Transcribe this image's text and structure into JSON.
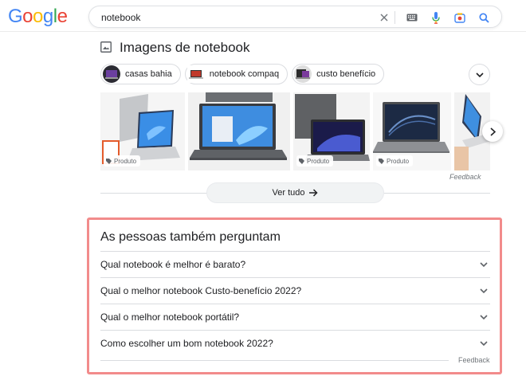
{
  "header": {
    "logo_letters": [
      {
        "char": "G",
        "color": "#4285F4"
      },
      {
        "char": "o",
        "color": "#EA4335"
      },
      {
        "char": "o",
        "color": "#FBBC05"
      },
      {
        "char": "g",
        "color": "#4285F4"
      },
      {
        "char": "l",
        "color": "#34A853"
      },
      {
        "char": "e",
        "color": "#EA4335"
      }
    ],
    "search_query": "notebook",
    "icons": [
      "clear-icon",
      "keyboard-icon",
      "microphone-icon",
      "camera-lens-icon",
      "search-icon"
    ]
  },
  "images": {
    "title": "Imagens de notebook",
    "chips": [
      {
        "label": "casas bahia"
      },
      {
        "label": "notebook compaq"
      },
      {
        "label": "custo benefício"
      }
    ],
    "tiles": [
      {
        "tag": "Produto"
      },
      {
        "tag": ""
      },
      {
        "tag": "Produto"
      },
      {
        "tag": "Produto"
      },
      {
        "tag": ""
      }
    ],
    "feedback": "Feedback",
    "see_all": "Ver tudo"
  },
  "paa": {
    "title": "As pessoas também perguntam",
    "questions": [
      "Qual notebook é melhor é barato?",
      "Qual o melhor notebook Custo-benefício 2022?",
      "Qual o melhor notebook portátil?",
      "Como escolher um bom notebook 2022?"
    ],
    "feedback": "Feedback"
  },
  "colors": {
    "highlight_border": "#f28b8b",
    "text": "#202124",
    "muted": "#70757a"
  }
}
